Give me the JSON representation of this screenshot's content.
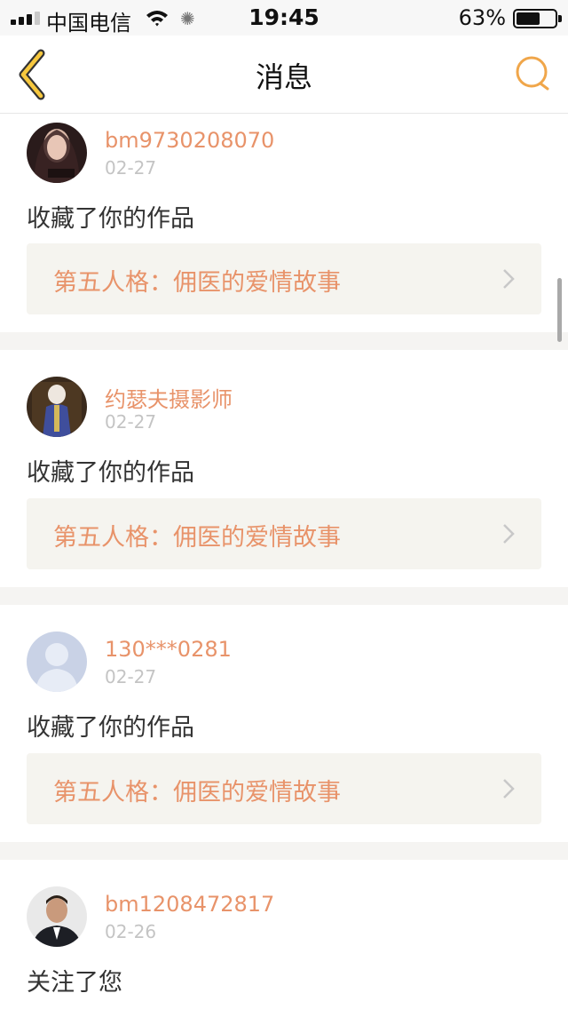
{
  "status_bar": {
    "carrier": "中国电信",
    "time": "19:45",
    "battery_percent": "63%",
    "battery_level": 0.63
  },
  "nav": {
    "title": "消息",
    "back_icon": "chevron-left-icon",
    "search_icon": "search-icon",
    "accent_color": "#f0a64a"
  },
  "colors": {
    "accent_text": "#e8936a",
    "work_background": "#f5f4ef",
    "separator": "#f5f4f2"
  },
  "messages": [
    {
      "username": "bm9730208070",
      "date": "02-27",
      "action": "收藏了你的作品",
      "work_title": "第五人格：佣医的爱情故事"
    },
    {
      "username": "约瑟夫摄影师",
      "date": "02-27",
      "action": "收藏了你的作品",
      "work_title": "第五人格：佣医的爱情故事"
    },
    {
      "username": "130***0281",
      "date": "02-27",
      "action": "收藏了你的作品",
      "work_title": "第五人格：佣医的爱情故事"
    },
    {
      "username": "bm1208472817",
      "date": "02-26",
      "action": "关注了您"
    }
  ]
}
